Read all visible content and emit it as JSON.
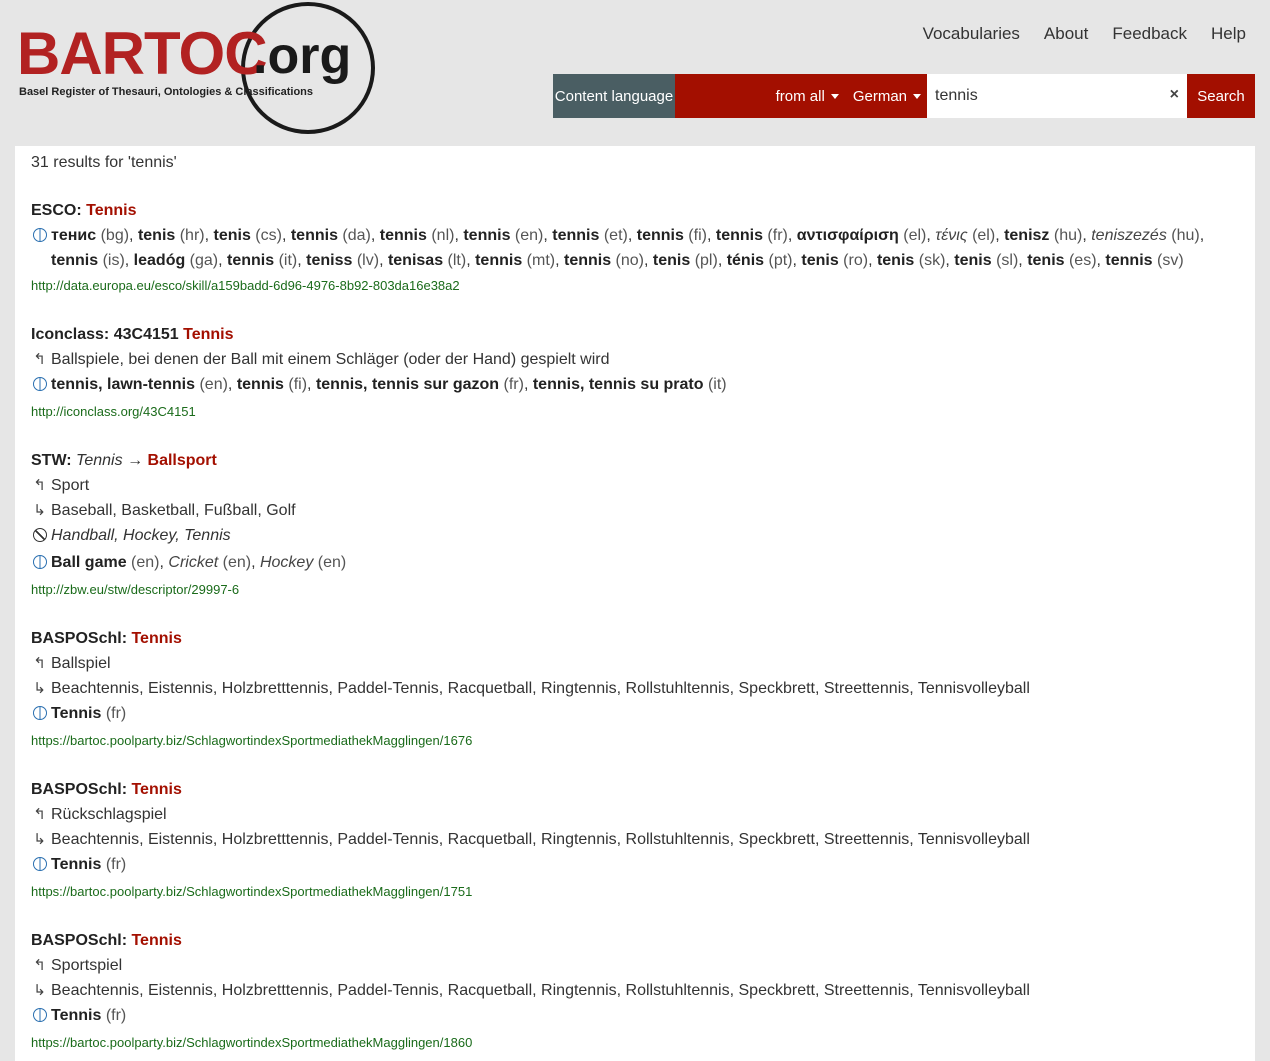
{
  "logo": {
    "word": "BARTOC",
    "suffix": ".org",
    "tagline": "Basel Register of Thesauri, Ontologies & Classifications"
  },
  "nav": [
    "Vocabularies",
    "About",
    "Feedback",
    "Help"
  ],
  "search": {
    "content_language_label": "Content language",
    "from_label": "from all",
    "language_label": "German",
    "query": "tennis",
    "clear_label": "×",
    "button_label": "Search"
  },
  "count_text": "31 results for 'tennis'",
  "results": [
    {
      "vocab": "ESCO:",
      "notation": "",
      "term": "Tennis",
      "uri": "http://data.europa.eu/esco/skill/a159badd-6d96-4976-8b92-803da16e38a2",
      "labels_line1": [
        {
          "t": "тенис",
          "l": "(bg)"
        },
        {
          "t": "tenis",
          "l": "(hr)"
        },
        {
          "t": "tenis",
          "l": "(cs)"
        },
        {
          "t": "tennis",
          "l": "(da)"
        },
        {
          "t": "tennis",
          "l": "(nl)"
        },
        {
          "t": "tennis",
          "l": "(en)"
        },
        {
          "t": "tennis",
          "l": "(et)"
        },
        {
          "t": "tennis",
          "l": "(fi)"
        },
        {
          "t": "tennis",
          "l": "(fr)"
        },
        {
          "t": "αντισφαίριση",
          "l": "(el)"
        },
        {
          "t": "τένις",
          "l": "(el)",
          "alt": true
        },
        {
          "t": "tenisz",
          "l": "(hu)"
        },
        {
          "t": "teniszezés",
          "l": "(hu)",
          "alt": true
        }
      ],
      "labels_line2": [
        {
          "t": "tennis",
          "l": "(is)"
        },
        {
          "t": "leadóg",
          "l": "(ga)"
        },
        {
          "t": "tennis",
          "l": "(it)"
        },
        {
          "t": "teniss",
          "l": "(lv)"
        },
        {
          "t": "tenisas",
          "l": "(lt)"
        },
        {
          "t": "tennis",
          "l": "(mt)"
        },
        {
          "t": "tennis",
          "l": "(no)"
        },
        {
          "t": "tenis",
          "l": "(pl)"
        },
        {
          "t": "ténis",
          "l": "(pt)"
        },
        {
          "t": "tenis",
          "l": "(ro)"
        },
        {
          "t": "tenis",
          "l": "(sk)"
        },
        {
          "t": "tenis",
          "l": "(sl)"
        },
        {
          "t": "tenis",
          "l": "(es)"
        },
        {
          "t": "tennis",
          "l": "(sv)"
        }
      ]
    },
    {
      "vocab": "Iconclass:",
      "notation": "43C4151",
      "term": "Tennis",
      "broader": "Ballspiele, bei denen der Ball mit einem Schläger (oder der Hand) gespielt wird",
      "labels": [
        {
          "t": "tennis, lawn-tennis",
          "l": "(en)"
        },
        {
          "t": "tennis",
          "l": "(fi)"
        },
        {
          "t": "tennis, tennis sur gazon",
          "l": "(fr)"
        },
        {
          "t": "tennis, tennis su prato",
          "l": "(it)"
        }
      ],
      "uri": "http://iconclass.org/43C4151"
    },
    {
      "vocab": "STW:",
      "alt_term": "Tennis",
      "arrow": "→",
      "term": "Ballsport",
      "broader": "Sport",
      "narrower": "Baseball, Basketball, Fußball, Golf",
      "hidden": "Handball, Hockey, Tennis",
      "labels": [
        {
          "t": "Ball game",
          "l": "(en)"
        },
        {
          "t": "Cricket",
          "l": "(en)",
          "alt": true
        },
        {
          "t": "Hockey",
          "l": "(en)",
          "alt": true
        }
      ],
      "uri": "http://zbw.eu/stw/descriptor/29997-6"
    },
    {
      "vocab": "BASPOSchl:",
      "term": "Tennis",
      "broader": "Ballspiel",
      "narrower": "Beachtennis, Eistennis, Holzbretttennis, Paddel-Tennis, Racquetball, Ringtennis, Rollstuhltennis, Speckbrett, Streettennis, Tennisvolleyball",
      "labels": [
        {
          "t": "Tennis",
          "l": "(fr)"
        }
      ],
      "uri": "https://bartoc.poolparty.biz/SchlagwortindexSportmediathekMagglingen/1676"
    },
    {
      "vocab": "BASPOSchl:",
      "term": "Tennis",
      "broader": "Rückschlagspiel",
      "narrower": "Beachtennis, Eistennis, Holzbretttennis, Paddel-Tennis, Racquetball, Ringtennis, Rollstuhltennis, Speckbrett, Streettennis, Tennisvolleyball",
      "labels": [
        {
          "t": "Tennis",
          "l": "(fr)"
        }
      ],
      "uri": "https://bartoc.poolparty.biz/SchlagwortindexSportmediathekMagglingen/1751"
    },
    {
      "vocab": "BASPOSchl:",
      "term": "Tennis",
      "broader": "Sportspiel",
      "narrower": "Beachtennis, Eistennis, Holzbretttennis, Paddel-Tennis, Racquetball, Ringtennis, Rollstuhltennis, Speckbrett, Streettennis, Tennisvolleyball",
      "labels": [
        {
          "t": "Tennis",
          "l": "(fr)"
        }
      ],
      "uri": "https://bartoc.poolparty.biz/SchlagwortindexSportmediathekMagglingen/1860"
    }
  ],
  "icons": {
    "broader": "arrow-up-left-icon",
    "narrower": "arrow-down-right-icon",
    "labels": "globe-icon",
    "hidden": "ban-icon"
  },
  "colors": {
    "accent_red": "#a30f00",
    "content_lang_bg": "#4a5e63",
    "uri_green": "#1a6b1a",
    "page_bg": "#e6e6e6"
  }
}
